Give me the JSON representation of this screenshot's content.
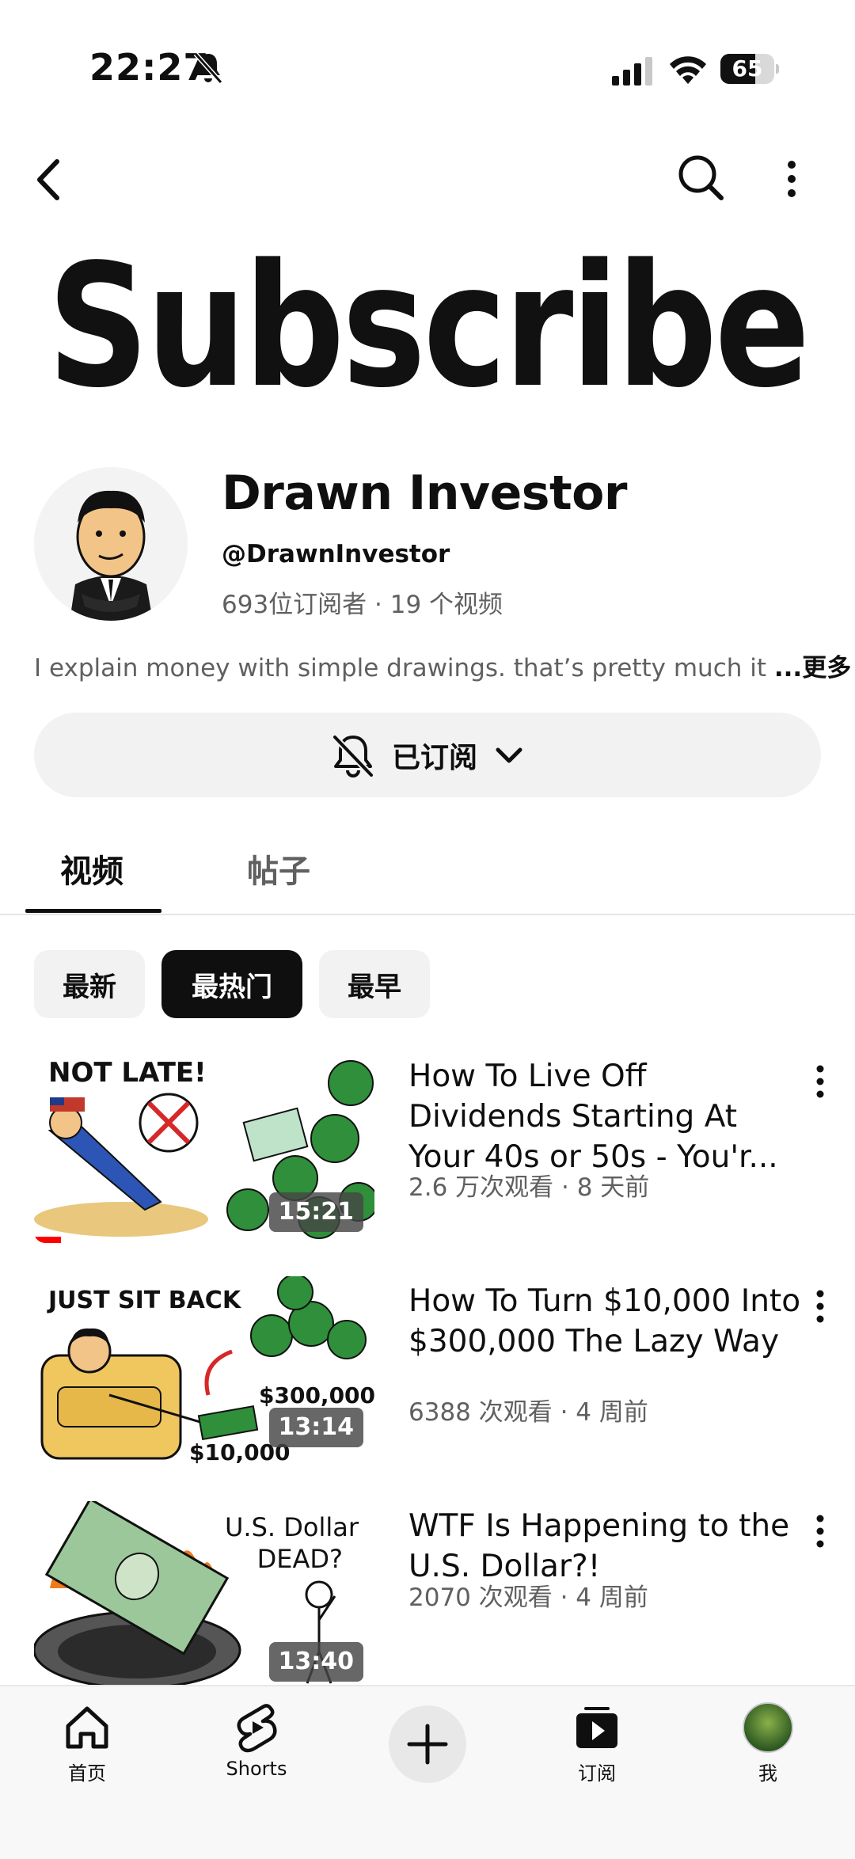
{
  "status_bar": {
    "time": "22:27",
    "battery": "65",
    "battery_level": 0.65
  },
  "banner": {
    "text": "Subscribe"
  },
  "channel": {
    "name": "Drawn Investor",
    "handle": "@DrawnInvestor",
    "stats": "693位订阅者 · 19 个视频",
    "description": "I explain money with simple drawings. that’s pretty much it ",
    "more_label": "...更多",
    "subscribed_label": "已订阅"
  },
  "tabs": [
    {
      "label": "视频"
    },
    {
      "label": "帖子"
    }
  ],
  "chips": [
    {
      "label": "最新"
    },
    {
      "label": "最热门"
    },
    {
      "label": "最早"
    }
  ],
  "videos": [
    {
      "title": "How To Live Off Dividends Starting At Your 40s or 50s - You'r...",
      "meta": "2.6 万次观看 · 8 天前",
      "duration": "15:21",
      "thumb_caption": "NOT LATE!",
      "watched_fraction": 0.08
    },
    {
      "title": "How To Turn $10,000 Into $300,000 The Lazy Way",
      "meta": "6388 次观看 · 4 周前",
      "duration": "13:14",
      "thumb_caption": "JUST SIT BACK",
      "thumb_amount_high": "$300,000",
      "thumb_amount_low": "$10,000"
    },
    {
      "title": "WTF Is Happening to the U.S. Dollar?!",
      "meta": "2070 次观看 · 4 周前",
      "duration": "13:40",
      "thumb_caption_1": "U.S. Dollar",
      "thumb_caption_2": "DEAD?"
    }
  ],
  "bottom_nav": {
    "home": "首页",
    "shorts": "Shorts",
    "subscriptions": "订阅",
    "me": "我"
  }
}
